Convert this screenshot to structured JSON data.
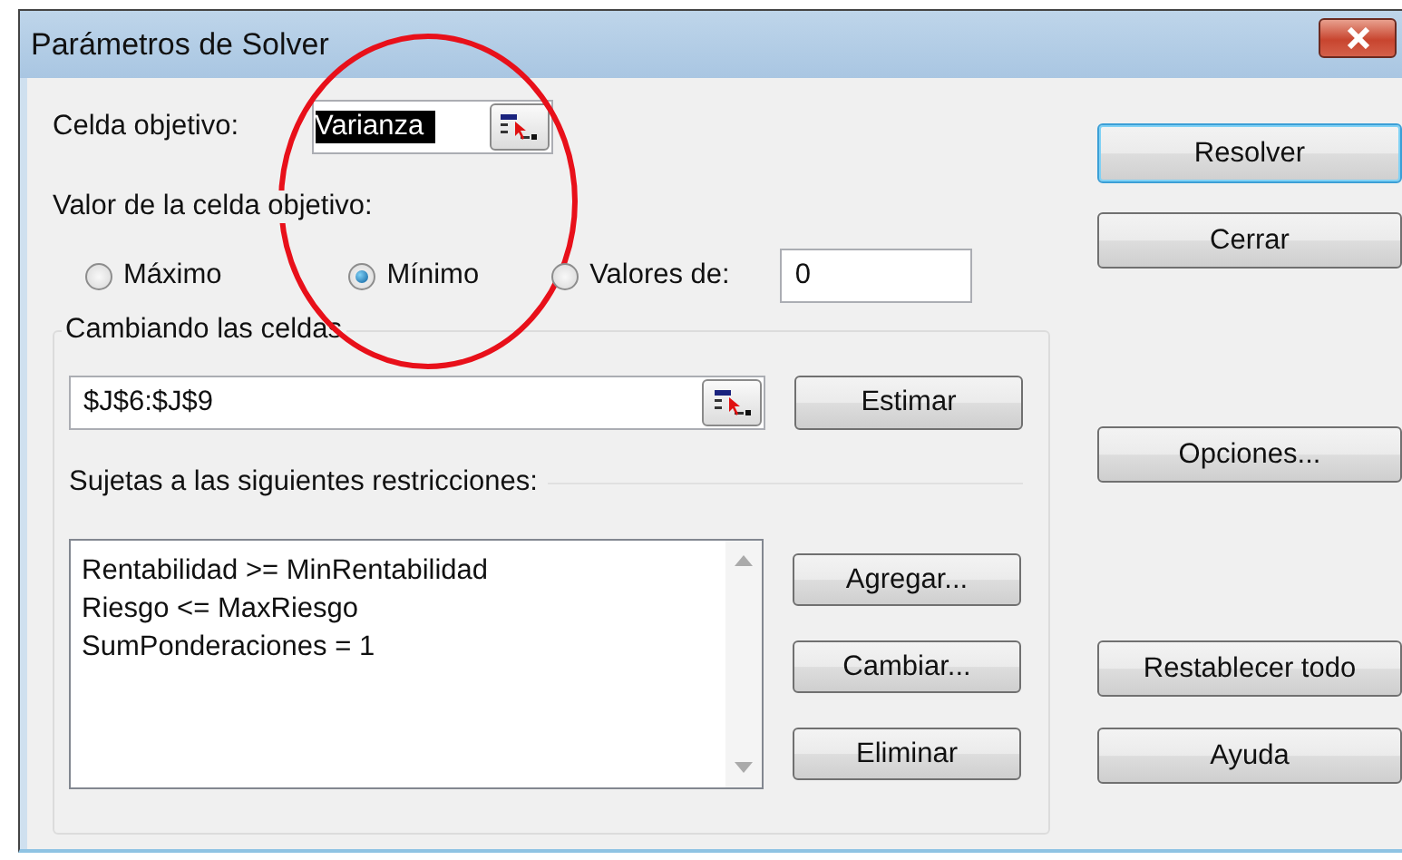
{
  "window": {
    "title": "Parámetros de Solver"
  },
  "target_cell": {
    "label": "Celda objetivo:",
    "value": "Varianza",
    "text_selected": true
  },
  "target_value": {
    "label": "Valor de la celda objetivo:",
    "options": [
      {
        "label": "Máximo",
        "selected": false
      },
      {
        "label": "Mínimo",
        "selected": true
      },
      {
        "label": "Valores de:",
        "selected": false
      }
    ],
    "value": "0"
  },
  "changing_cells": {
    "label": "Cambiando las celdas",
    "value": "$J$6:$J$9",
    "button": "Estimar"
  },
  "constraints": {
    "label": "Sujetas a las siguientes restricciones:",
    "items": [
      "Rentabilidad >= MinRentabilidad",
      "Riesgo <= MaxRiesgo",
      "SumPonderaciones = 1"
    ],
    "buttons": [
      "Agregar...",
      "Cambiar...",
      "Eliminar"
    ]
  },
  "side_buttons": [
    {
      "label": "Resolver",
      "focused": true
    },
    {
      "label": "Cerrar",
      "focused": false
    },
    {
      "label": "Opciones...",
      "focused": false
    },
    {
      "label": "Restablecer todo",
      "focused": false
    },
    {
      "label": "Ayuda",
      "focused": false
    }
  ]
}
